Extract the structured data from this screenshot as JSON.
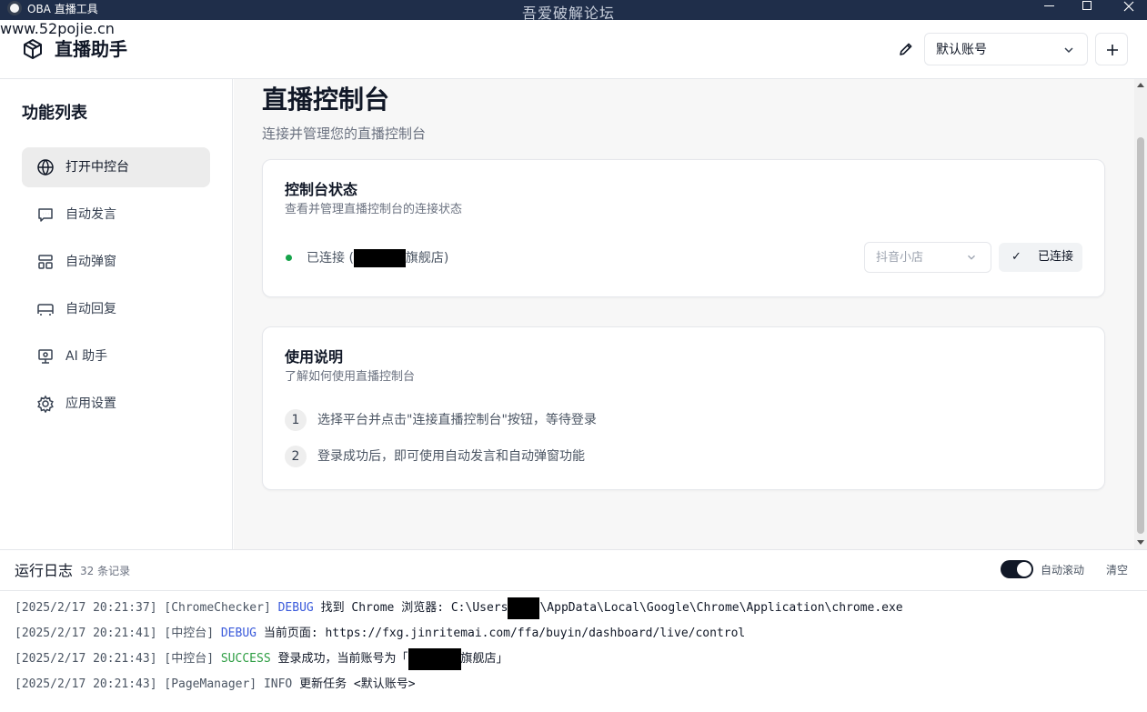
{
  "window": {
    "title": "OBA 直播工具",
    "watermark": "吾爱破解论坛",
    "watermark_sub": "www.52pojie.cn"
  },
  "header": {
    "brand": "直播助手",
    "account_select": "默认账号"
  },
  "sidebar": {
    "title": "功能列表",
    "items": [
      {
        "label": "打开中控台",
        "icon": "globe-icon",
        "active": true
      },
      {
        "label": "自动发言",
        "icon": "message-icon",
        "active": false
      },
      {
        "label": "自动弹窗",
        "icon": "layout-icon",
        "active": false
      },
      {
        "label": "自动回复",
        "icon": "reply-icon",
        "active": false
      },
      {
        "label": "AI 助手",
        "icon": "monitor-icon",
        "active": false
      },
      {
        "label": "应用设置",
        "icon": "gear-icon",
        "active": false
      }
    ]
  },
  "main": {
    "title": "直播控制台",
    "subtitle": "连接并管理您的直播控制台",
    "status_card": {
      "title": "控制台状态",
      "description": "查看并管理直播控制台的连接状态",
      "status_prefix": "已连接 (",
      "status_suffix": "旗舰店)",
      "platform": "抖音小店",
      "connected_label": "已连接",
      "status_color": "#16a34a"
    },
    "help_card": {
      "title": "使用说明",
      "description": "了解如何使用直播控制台",
      "steps": [
        {
          "num": "1",
          "text": "选择平台并点击\"连接直播控制台\"按钮，等待登录"
        },
        {
          "num": "2",
          "text": "登录成功后，即可使用自动发言和自动弹窗功能"
        }
      ]
    }
  },
  "log": {
    "title": "运行日志",
    "count": "32 条记录",
    "auto_scroll_label": "自动滚动",
    "auto_scroll_on": true,
    "clear_label": "清空",
    "lines": [
      {
        "time": "[2025/2/17 20:21:37]",
        "source": "[ChromeChecker]",
        "level": "DEBUG",
        "msg_a": "找到 Chrome 浏览器: C:\\Users",
        "msg_b": "\\AppData\\Local\\Google\\Chrome\\Application\\chrome.exe"
      },
      {
        "time": "[2025/2/17 20:21:41]",
        "source": "[中控台]",
        "level": "DEBUG",
        "msg_a": "当前页面: https://fxg.jinritemai.com/ffa/buyin/dashboard/live/control",
        "msg_b": ""
      },
      {
        "time": "[2025/2/17 20:21:43]",
        "source": "[中控台]",
        "level": "SUCCESS",
        "msg_a": "登录成功，当前账号为「",
        "msg_b": "旗舰店」"
      },
      {
        "time": "[2025/2/17 20:21:43]",
        "source": "[PageManager]",
        "level": "INFO",
        "msg_a": "更新任务 <默认账号>",
        "msg_b": ""
      }
    ]
  }
}
